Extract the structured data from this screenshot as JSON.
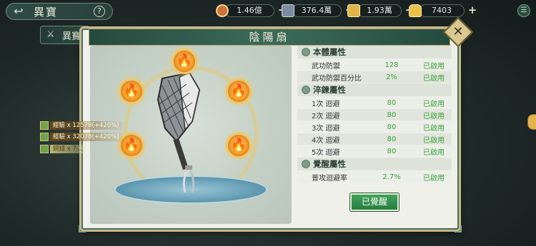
{
  "topbar": {
    "title": "異寶",
    "help": "?",
    "resources": [
      {
        "name": "copper-coin",
        "value": "1.46億",
        "color": "#c9743a"
      },
      {
        "name": "silver-ingot",
        "value": "376.4萬",
        "color": "#7a8ca0"
      },
      {
        "name": "gold-ingot",
        "value": "1.93萬",
        "color": "#e0b548"
      },
      {
        "name": "yuanbao",
        "value": "7403",
        "color": "#e9c24a"
      }
    ]
  },
  "under_tab": {
    "label": "異寶"
  },
  "panel": {
    "title": "陰陽扇",
    "sections": [
      {
        "title": "本體屬性",
        "rows": [
          {
            "name": "武功防禦",
            "value": "128",
            "status": "已啟用"
          },
          {
            "name": "武功防禦百分比",
            "value": "2%",
            "status": "已啟用"
          }
        ]
      },
      {
        "title": "淬鍊屬性",
        "rows": [
          {
            "name": "1次  迴避",
            "value": "80",
            "status": "已啟用"
          },
          {
            "name": "2次  迴避",
            "value": "80",
            "status": "已啟用"
          },
          {
            "name": "3次  迴避",
            "value": "80",
            "status": "已啟用"
          },
          {
            "name": "4次  迴避",
            "value": "80",
            "status": "已啟用"
          },
          {
            "name": "5次  迴避",
            "value": "80",
            "status": "已啟用"
          }
        ]
      },
      {
        "title": "覺醒屬性",
        "rows": [
          {
            "name": "普攻迴避率",
            "value": "2.7%",
            "status": "已啟用"
          }
        ]
      }
    ],
    "awaken_button": "已覺醒"
  },
  "rewards": [
    {
      "text": "經驗 x 12578(+420%)"
    },
    {
      "text": "經驗 x 32078(+420%)"
    },
    {
      "text": "銅錢 x 7..."
    }
  ]
}
